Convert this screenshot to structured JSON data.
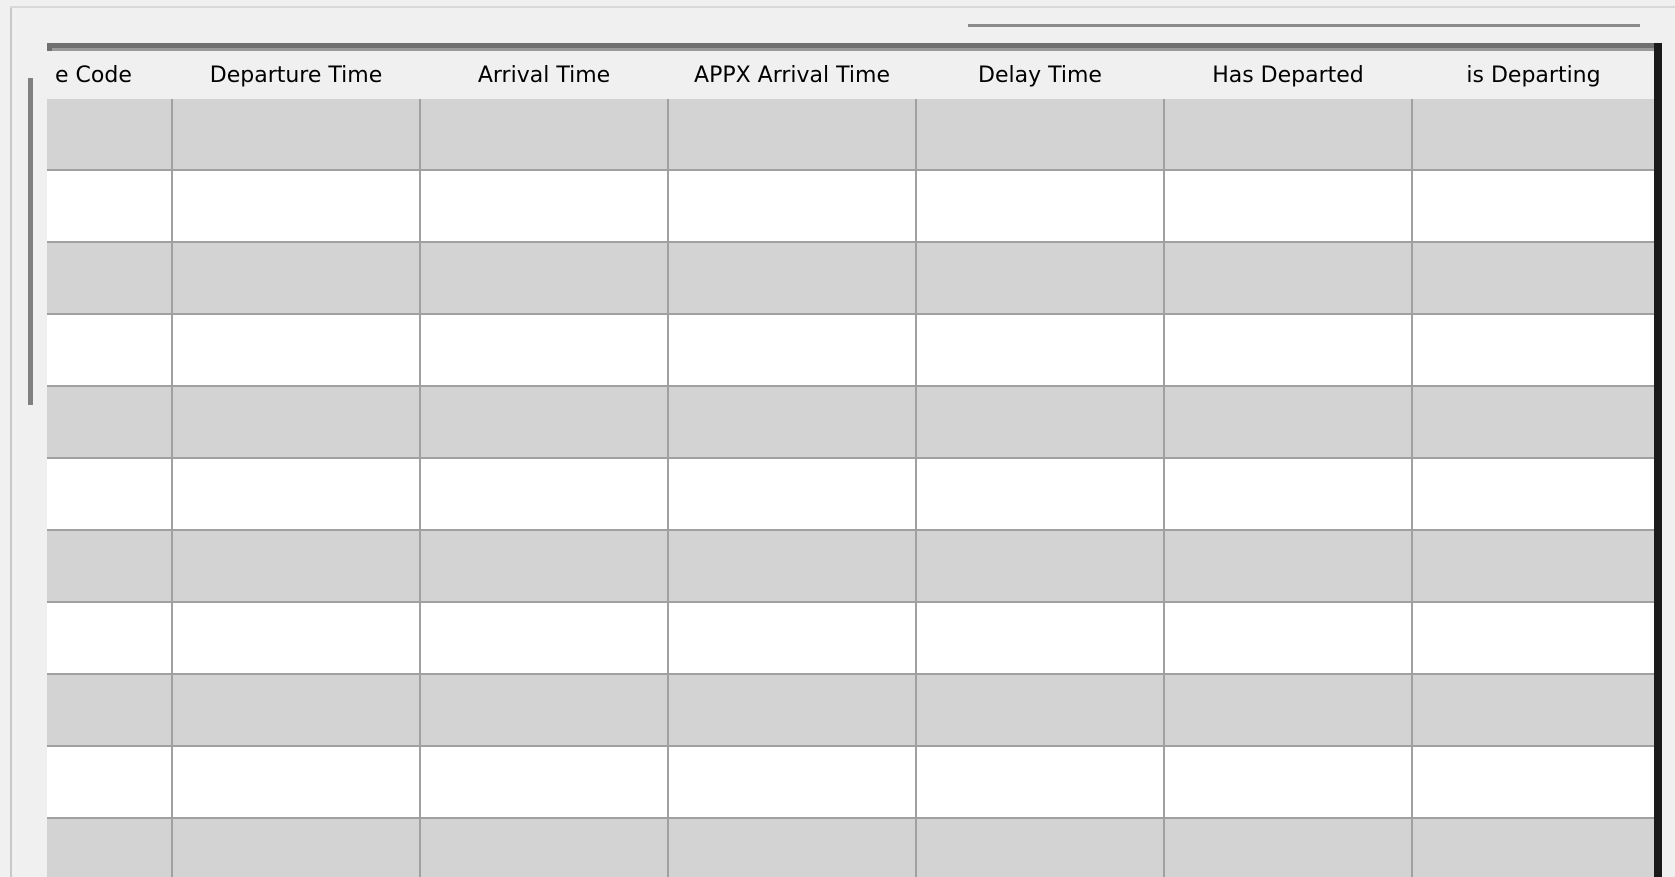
{
  "table": {
    "columns": [
      {
        "label": "e Code"
      },
      {
        "label": "Departure Time"
      },
      {
        "label": "Arrival Time"
      },
      {
        "label": "APPX Arrival Time"
      },
      {
        "label": "Delay Time"
      },
      {
        "label": "Has Departed"
      },
      {
        "label": "is Departing"
      }
    ],
    "rows": [
      {
        "shade": "gray",
        "cells": [
          "",
          "",
          "",
          "",
          "",
          "",
          ""
        ]
      },
      {
        "shade": "white",
        "cells": [
          "",
          "",
          "",
          "",
          "",
          "",
          ""
        ]
      },
      {
        "shade": "gray",
        "cells": [
          "",
          "",
          "",
          "",
          "",
          "",
          ""
        ]
      },
      {
        "shade": "white",
        "cells": [
          "",
          "",
          "",
          "",
          "",
          "",
          ""
        ]
      },
      {
        "shade": "gray",
        "cells": [
          "",
          "",
          "",
          "",
          "",
          "",
          ""
        ]
      },
      {
        "shade": "white",
        "cells": [
          "",
          "",
          "",
          "",
          "",
          "",
          ""
        ]
      },
      {
        "shade": "gray",
        "cells": [
          "",
          "",
          "",
          "",
          "",
          "",
          ""
        ]
      },
      {
        "shade": "white",
        "cells": [
          "",
          "",
          "",
          "",
          "",
          "",
          ""
        ]
      },
      {
        "shade": "gray",
        "cells": [
          "",
          "",
          "",
          "",
          "",
          "",
          ""
        ]
      },
      {
        "shade": "white",
        "cells": [
          "",
          "",
          "",
          "",
          "",
          "",
          ""
        ]
      },
      {
        "shade": "gray",
        "cells": [
          "",
          "",
          "",
          "",
          "",
          "",
          ""
        ]
      }
    ]
  },
  "colors": {
    "row_gray": "#d3d3d3",
    "row_white": "#ffffff",
    "grid_line": "#a0a0a0",
    "header_bg": "#f0f0f0"
  }
}
